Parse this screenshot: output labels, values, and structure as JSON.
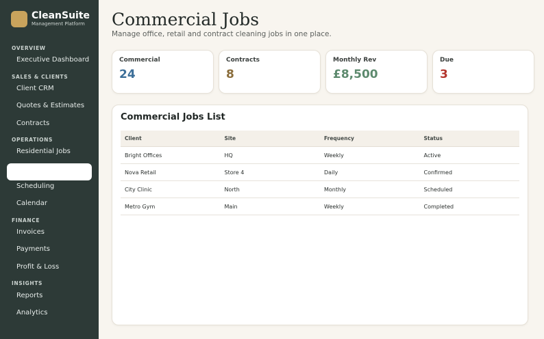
{
  "brand": {
    "name": "CleanSuite",
    "subtitle": "Management Platform"
  },
  "sidebar": {
    "sections": {
      "overview": "OVERVIEW",
      "sales": "SALES & CLIENTS",
      "operations": "OPERATIONS",
      "finance": "FINANCE",
      "insights": "INSIGHTS"
    },
    "items": {
      "dashboard": "Executive Dashboard",
      "crm": "Client CRM",
      "quotes": "Quotes & Estimates",
      "contracts": "Contracts",
      "residential": "Residential Jobs",
      "commercial": "",
      "scheduling": "Scheduling",
      "calendar": "Calendar",
      "invoices": "Invoices",
      "payments": "Payments",
      "pl": "Profit & Loss",
      "reports": "Reports",
      "analytics": "Analytics"
    }
  },
  "header": {
    "title": "Commercial Jobs",
    "subtitle": "Manage office, retail and contract cleaning jobs in one place."
  },
  "stats": [
    {
      "label": "Commercial",
      "value": "24",
      "color": "#3d6f99"
    },
    {
      "label": "Contracts",
      "value": "8",
      "color": "#8a6d3b"
    },
    {
      "label": "Monthly Rev",
      "value": "£8,500",
      "color": "#5d8a6e"
    },
    {
      "label": "Due",
      "value": "3",
      "color": "#b4362e"
    }
  ],
  "jobs": {
    "title": "Commercial Jobs List",
    "columns": [
      "Client",
      "Site",
      "Frequency",
      "Status"
    ],
    "rows": [
      [
        "Bright Offices",
        "HQ",
        "Weekly",
        "Active"
      ],
      [
        "Nova Retail",
        "Store 4",
        "Daily",
        "Confirmed"
      ],
      [
        "City Clinic",
        "North",
        "Monthly",
        "Scheduled"
      ],
      [
        "Metro Gym",
        "Main",
        "Weekly",
        "Completed"
      ]
    ]
  }
}
